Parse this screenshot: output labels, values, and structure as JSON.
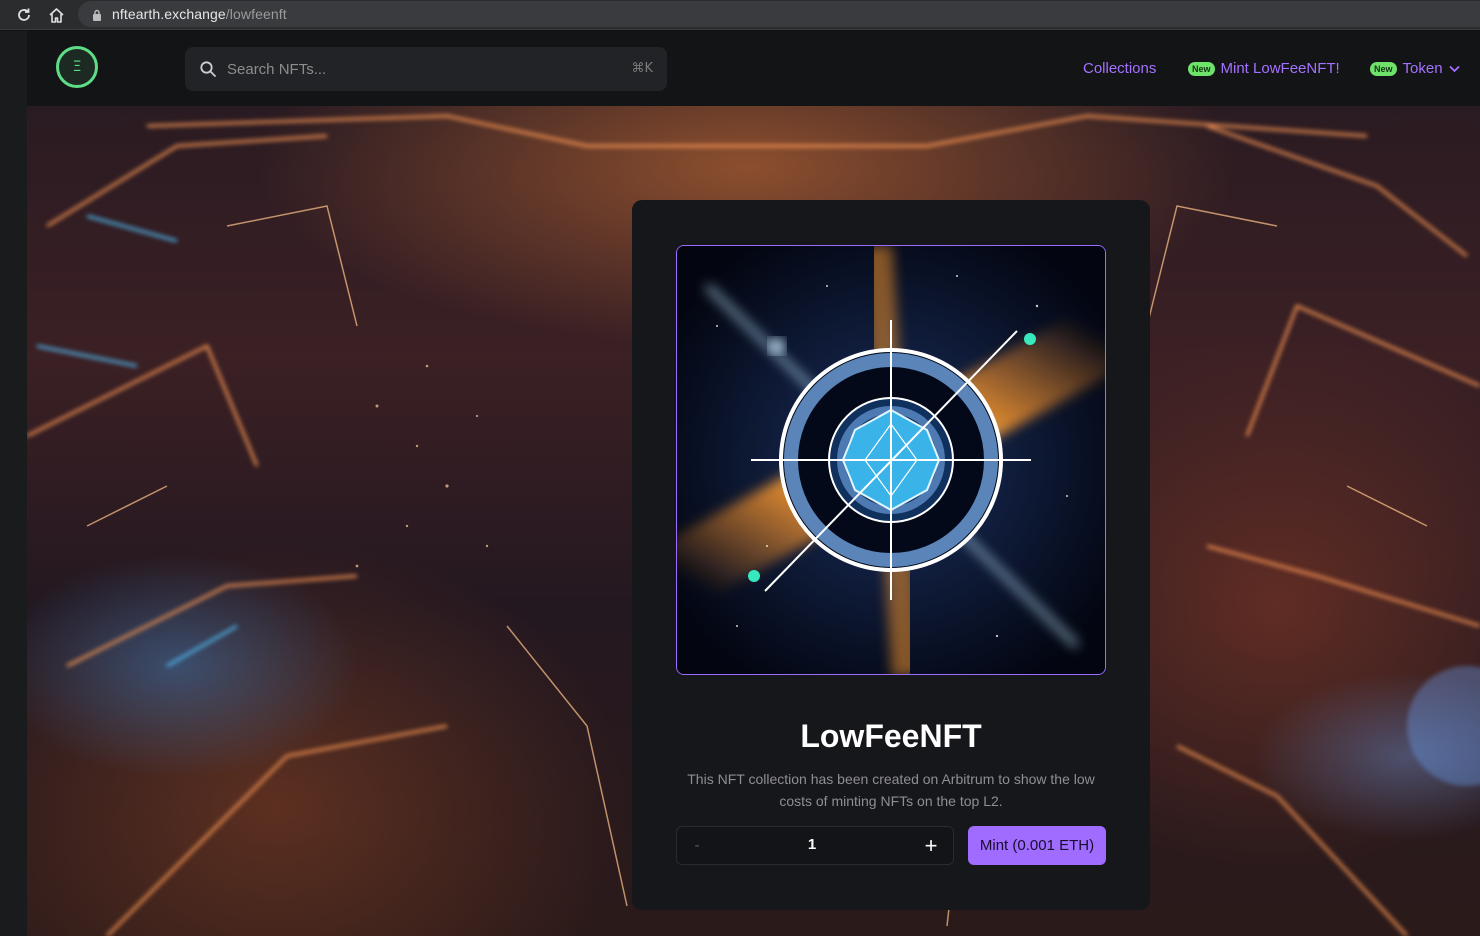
{
  "browser": {
    "url_host": "nftearth.exchange",
    "url_path": "/lowfeenft"
  },
  "header": {
    "logo_glyph": "Ξ",
    "search": {
      "placeholder": "Search NFTs...",
      "shortcut": "⌘K"
    },
    "nav": {
      "collections": "Collections",
      "mint_badge": "New",
      "mint_label": "Mint LowFeeNFT!",
      "token_badge": "New",
      "token_label": "Token"
    }
  },
  "card": {
    "title": "LowFeeNFT",
    "description": "This NFT collection has been created on Arbitrum to show the low costs of minting NFTs on the top L2.",
    "stepper": {
      "minus": "-",
      "quantity": "1",
      "plus": "+"
    },
    "mint_button": "Mint (0.001 ETH)"
  },
  "colors": {
    "accent": "#a472ff",
    "badge": "#6ee26a",
    "logo": "#5fdc86"
  }
}
